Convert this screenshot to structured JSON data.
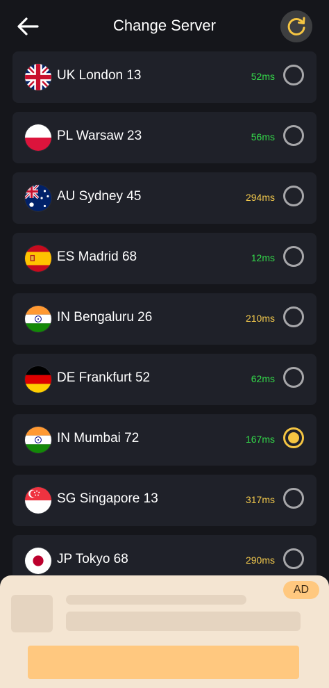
{
  "header": {
    "title": "Change Server",
    "back_icon": "arrow-left-icon",
    "refresh_icon": "refresh-icon",
    "accent": "#f5c542"
  },
  "servers": [
    {
      "name": "UK London 13",
      "ping": "52ms",
      "ping_color": "#34d94a",
      "flag": "uk-flag-icon",
      "selected": false
    },
    {
      "name": "PL Warsaw 23",
      "ping": "56ms",
      "ping_color": "#34d94a",
      "flag": "poland-flag-icon",
      "selected": false
    },
    {
      "name": "AU Sydney 45",
      "ping": "294ms",
      "ping_color": "#f2c94c",
      "flag": "australia-flag-icon",
      "selected": false
    },
    {
      "name": "ES Madrid 68",
      "ping": "12ms",
      "ping_color": "#34d94a",
      "flag": "spain-flag-icon",
      "selected": false
    },
    {
      "name": "IN Bengaluru 26",
      "ping": "210ms",
      "ping_color": "#f2c94c",
      "flag": "india-flag-icon",
      "selected": false
    },
    {
      "name": "DE Frankfurt 52",
      "ping": "62ms",
      "ping_color": "#34d94a",
      "flag": "germany-flag-icon",
      "selected": false
    },
    {
      "name": "IN Mumbai 72",
      "ping": "167ms",
      "ping_color": "#34d94a",
      "flag": "india-flag-icon",
      "selected": true
    },
    {
      "name": "SG Singapore 13",
      "ping": "317ms",
      "ping_color": "#f2c94c",
      "flag": "singapore-flag-icon",
      "selected": false
    },
    {
      "name": "JP Tokyo 68",
      "ping": "290ms",
      "ping_color": "#f2c94c",
      "flag": "japan-flag-icon",
      "selected": false
    }
  ],
  "ad": {
    "badge": "AD",
    "colors": {
      "panel": "#f4e5d2",
      "placeholder": "#e5d4c0",
      "cta": "#ffc87f"
    }
  }
}
